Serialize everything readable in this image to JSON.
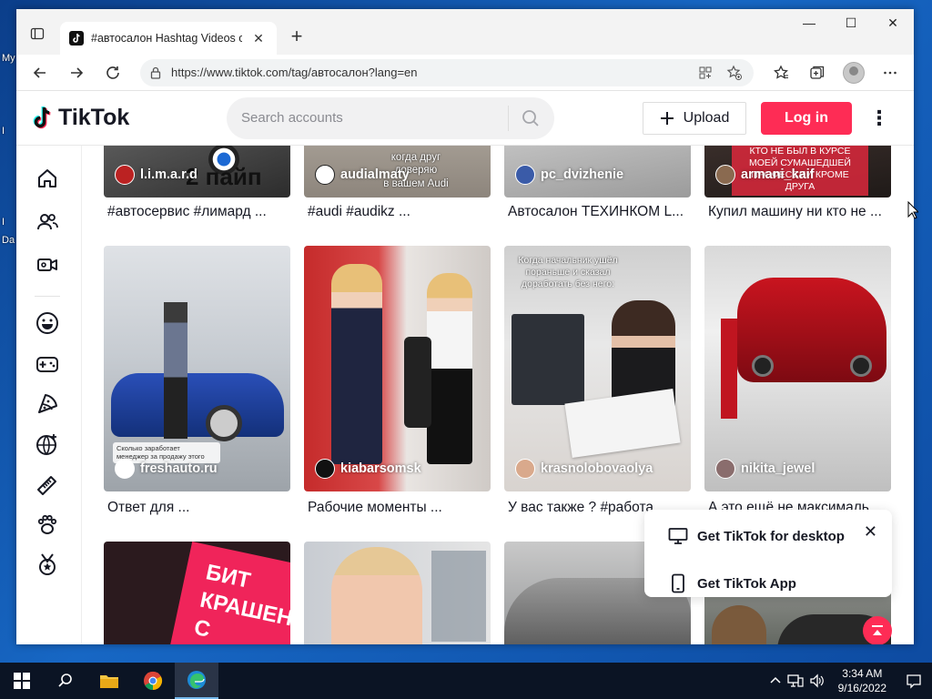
{
  "desktop": {
    "icon_labels": [
      "My",
      "I",
      "I",
      "Da"
    ]
  },
  "browser": {
    "tab_title": "#автосалон Hashtag Videos on TikTok",
    "url": "https://www.tiktok.com/tag/автосалон?lang=en",
    "new_tab": "+",
    "close": "✕",
    "window": {
      "minimize": "—",
      "maximize": "☐",
      "close": "✕"
    }
  },
  "header": {
    "logo": "TikTok",
    "search_placeholder": "Search accounts",
    "upload": "Upload",
    "login": "Log in",
    "more": "⋮"
  },
  "sidebar": {
    "icons": [
      "home-icon",
      "following-icon",
      "live-icon",
      "comedy-icon",
      "gaming-icon",
      "food-icon",
      "sports-icon",
      "beauty-icon",
      "animals-icon",
      "achievement-icon"
    ]
  },
  "videos": {
    "row1": [
      {
        "author": "l.i.m.a.r.d",
        "caption": "#автосервис #лимард ...",
        "overlay": "2 пайп"
      },
      {
        "author": "audialmaty",
        "caption": "#audi #audikz ...",
        "overlay": "когда друг\nдоверяю\nв вашем Audi"
      },
      {
        "author": "pc_dvizhenie",
        "caption": "Автосалон ТЕХИНКОМ L...",
        "overlay": ""
      },
      {
        "author": "armani_kaif",
        "caption": "Купил машину ни кто не ...",
        "overlay": "КТО НЕ БЫЛ В КУРСЕ\nМОЕЙ СУМАШЕДШЕЙ\nПРОФЕССИИ КРОМЕ\nДРУГА"
      }
    ],
    "row2": [
      {
        "author": "freshauto.ru",
        "caption": "Ответ для ...",
        "overlay": "Сколько заработает\nменеджер за продажу этого"
      },
      {
        "author": "kiabarsomsk",
        "caption": "Рабочие моменты ...",
        "overlay": ""
      },
      {
        "author": "krasnolobovaolya",
        "caption": "У вас также ? #работа ...",
        "overlay": "Когда начальник ушёл\nпораньше и сказал\nдоработать без него:"
      },
      {
        "author": "nikita_jewel",
        "caption": "А это ещё не максималь...",
        "overlay": ""
      }
    ],
    "row3_overlays": [
      "БИТ\nКРАШЕН\nС",
      "",
      "",
      ""
    ]
  },
  "popup": {
    "desktop": "Get TikTok for desktop",
    "app": "Get TikTok App",
    "close": "✕"
  },
  "taskbar": {
    "time": "3:34 AM",
    "date": "9/16/2022"
  }
}
